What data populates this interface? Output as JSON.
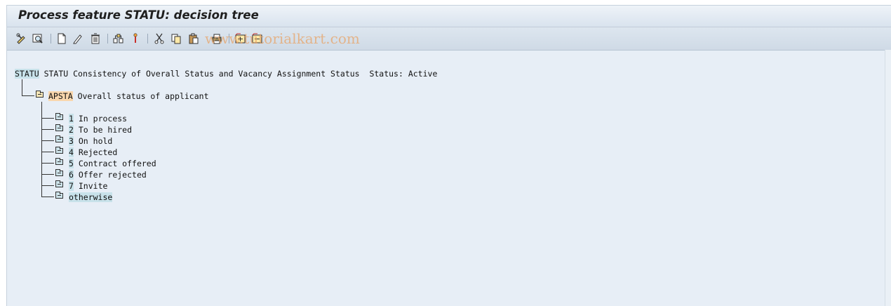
{
  "window": {
    "title": "Process feature STATU: decision tree",
    "watermark": "www.tutorialkart.com"
  },
  "toolbar": {
    "buttons": [
      {
        "name": "display-change-icon"
      },
      {
        "name": "find-icon"
      },
      {
        "name": "create-icon"
      },
      {
        "name": "change-icon"
      },
      {
        "name": "delete-icon"
      },
      {
        "name": "navigate-icon"
      },
      {
        "name": "pointer-icon"
      },
      {
        "name": "cut-icon"
      },
      {
        "name": "copy-icon"
      },
      {
        "name": "paste-icon"
      },
      {
        "name": "print-icon"
      },
      {
        "name": "expand-icon"
      },
      {
        "name": "collapse-icon"
      }
    ]
  },
  "tree": {
    "root": {
      "code": "STATU",
      "text": "STATU Consistency of Overall Status and Vacancy Assignment Status  Status: Active"
    },
    "field": {
      "code": "APSTA",
      "text": "Overall status of applicant"
    },
    "values": [
      {
        "code": "1",
        "label": "In process"
      },
      {
        "code": "2",
        "label": "To be hired"
      },
      {
        "code": "3",
        "label": "On hold"
      },
      {
        "code": "4",
        "label": "Rejected"
      },
      {
        "code": "5",
        "label": "Contract offered"
      },
      {
        "code": "6",
        "label": "Offer rejected"
      },
      {
        "code": "7",
        "label": "Invite"
      },
      {
        "code": "otherwise",
        "label": ""
      }
    ]
  }
}
